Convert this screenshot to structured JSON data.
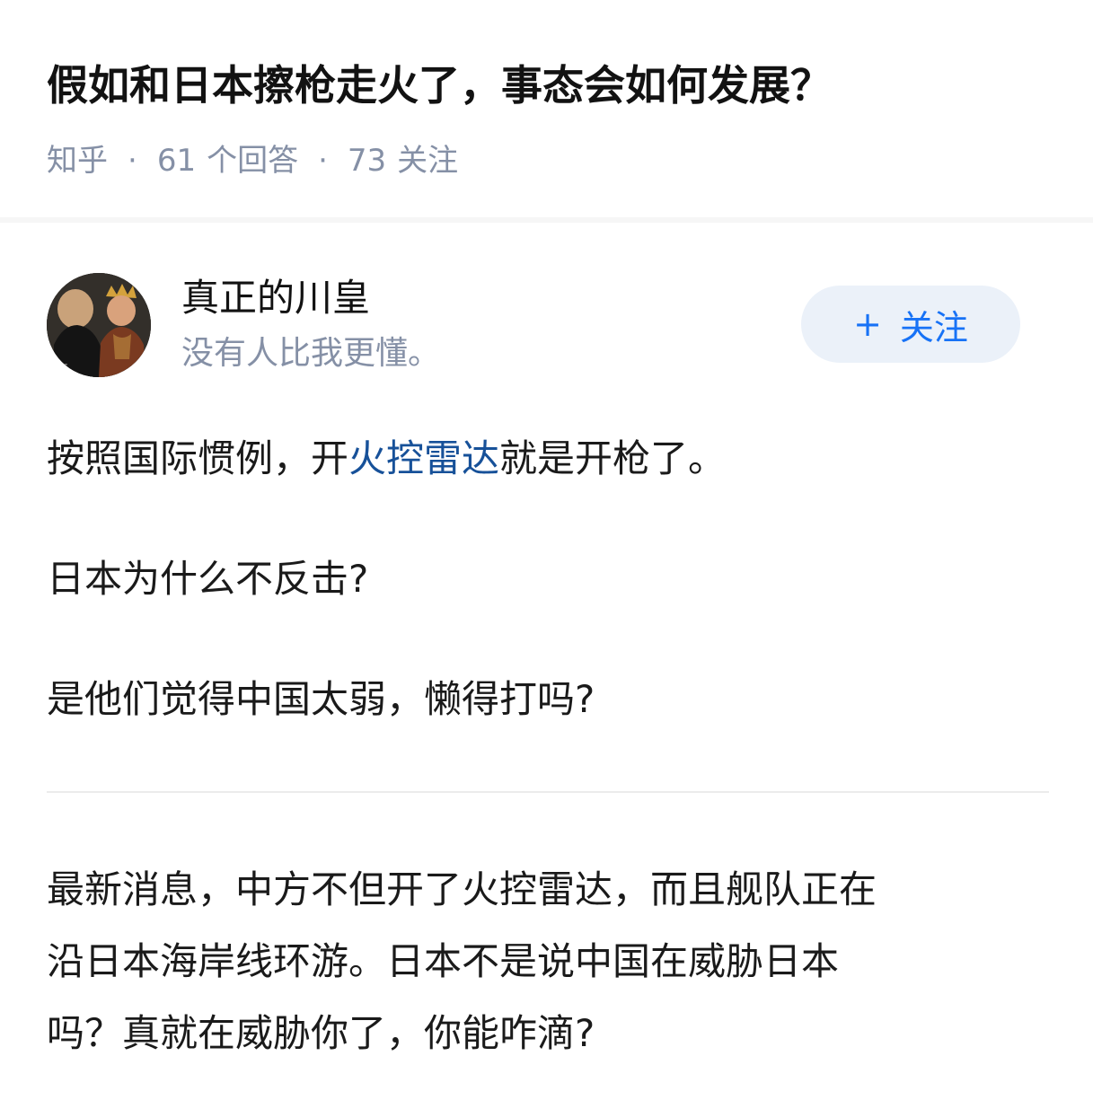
{
  "question": {
    "title": "假如和日本擦枪走火了，事态会如何发展？",
    "source": "知乎",
    "answer_count": "61",
    "answer_label": "个回答",
    "follower_count": "73",
    "follower_label": "关注"
  },
  "author": {
    "name": "真正的川皇",
    "bio": "没有人比我更懂。",
    "follow_plus": "+",
    "follow_label": "关注"
  },
  "answer": {
    "p1_before": "按照国际惯例，开",
    "p1_link": "火控雷达",
    "p1_after": "就是开枪了。",
    "p2": "日本为什么不反击?",
    "p3": "是他们觉得中国太弱，懒得打吗?",
    "p4_line1": "最新消息，中方不但开了火控雷达，而且舰队正在",
    "p4_line2": "沿日本海岸线环游。日本不是说中国在威胁日本",
    "p4_line3": "吗？真就在威胁你了，你能咋滴?"
  },
  "colors": {
    "link": "#175199",
    "meta": "#8590a6",
    "follow_text": "#1772f6",
    "follow_bg": "#ebf1f9"
  }
}
